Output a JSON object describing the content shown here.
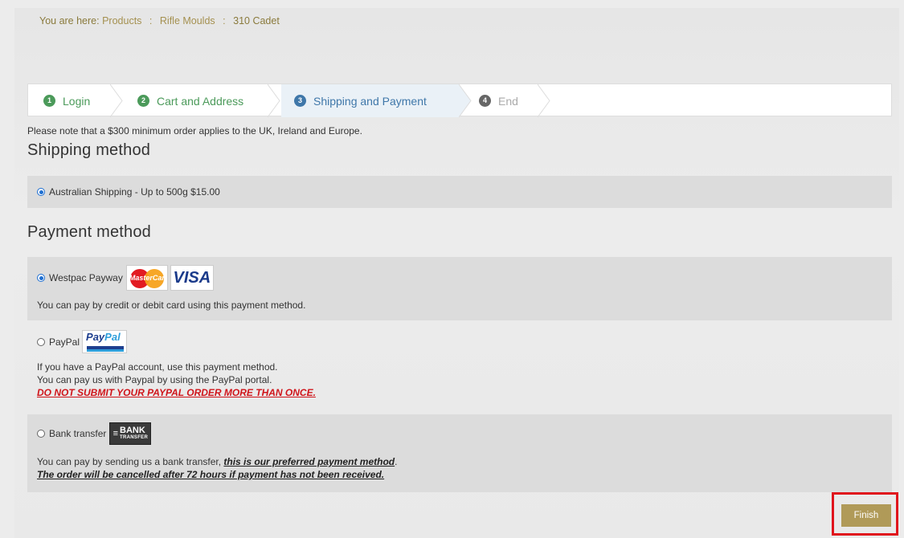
{
  "breadcrumb": {
    "prefix": "You are here:",
    "items": [
      "Products",
      "Rifle Moulds",
      "310 Cadet"
    ],
    "separator": ":"
  },
  "steps": [
    {
      "num": "1",
      "label": "Login",
      "state": "done"
    },
    {
      "num": "2",
      "label": "Cart and Address",
      "state": "done"
    },
    {
      "num": "3",
      "label": "Shipping and Payment",
      "state": "active"
    },
    {
      "num": "4",
      "label": "End",
      "state": "future"
    }
  ],
  "notice": "Please note that a $300 minimum order applies to the UK, Ireland and Europe.",
  "shipping": {
    "heading": "Shipping method",
    "option_label": "Australian Shipping - Up to 500g $15.00",
    "selected": true
  },
  "payment": {
    "heading": "Payment method",
    "westpac": {
      "label": "Westpac Payway",
      "desc": "You can pay by credit or debit card using this payment method.",
      "logo_mc_text": "MasterCard",
      "logo_visa_text": "VISA",
      "selected": true
    },
    "paypal": {
      "label": "PayPal",
      "logo_text_a": "Pay",
      "logo_text_b": "Pal",
      "desc_line1": "If you have a PayPal account, use this payment method.",
      "desc_line2": "You can pay us with Paypal by using the PayPal portal.",
      "warning": "DO NOT SUBMIT YOUR PAYPAL ORDER MORE THAN ONCE.",
      "selected": false
    },
    "bank": {
      "label": "Bank transfer",
      "logo_l1": "BANK",
      "logo_l2": "TRANSFER",
      "desc_prefix": "You can pay by sending us a bank transfer, ",
      "desc_emph": "this is our preferred payment method",
      "desc_suffix": ".",
      "warning": "The order will be cancelled after 72 hours if payment has not been received.",
      "selected": false
    }
  },
  "finish_label": "Finish",
  "colors": {
    "accent": "#b09a58",
    "step_done": "#4b9a5a",
    "step_active": "#3f77a9",
    "warning": "#d0151b",
    "highlight": "#e0141c"
  }
}
